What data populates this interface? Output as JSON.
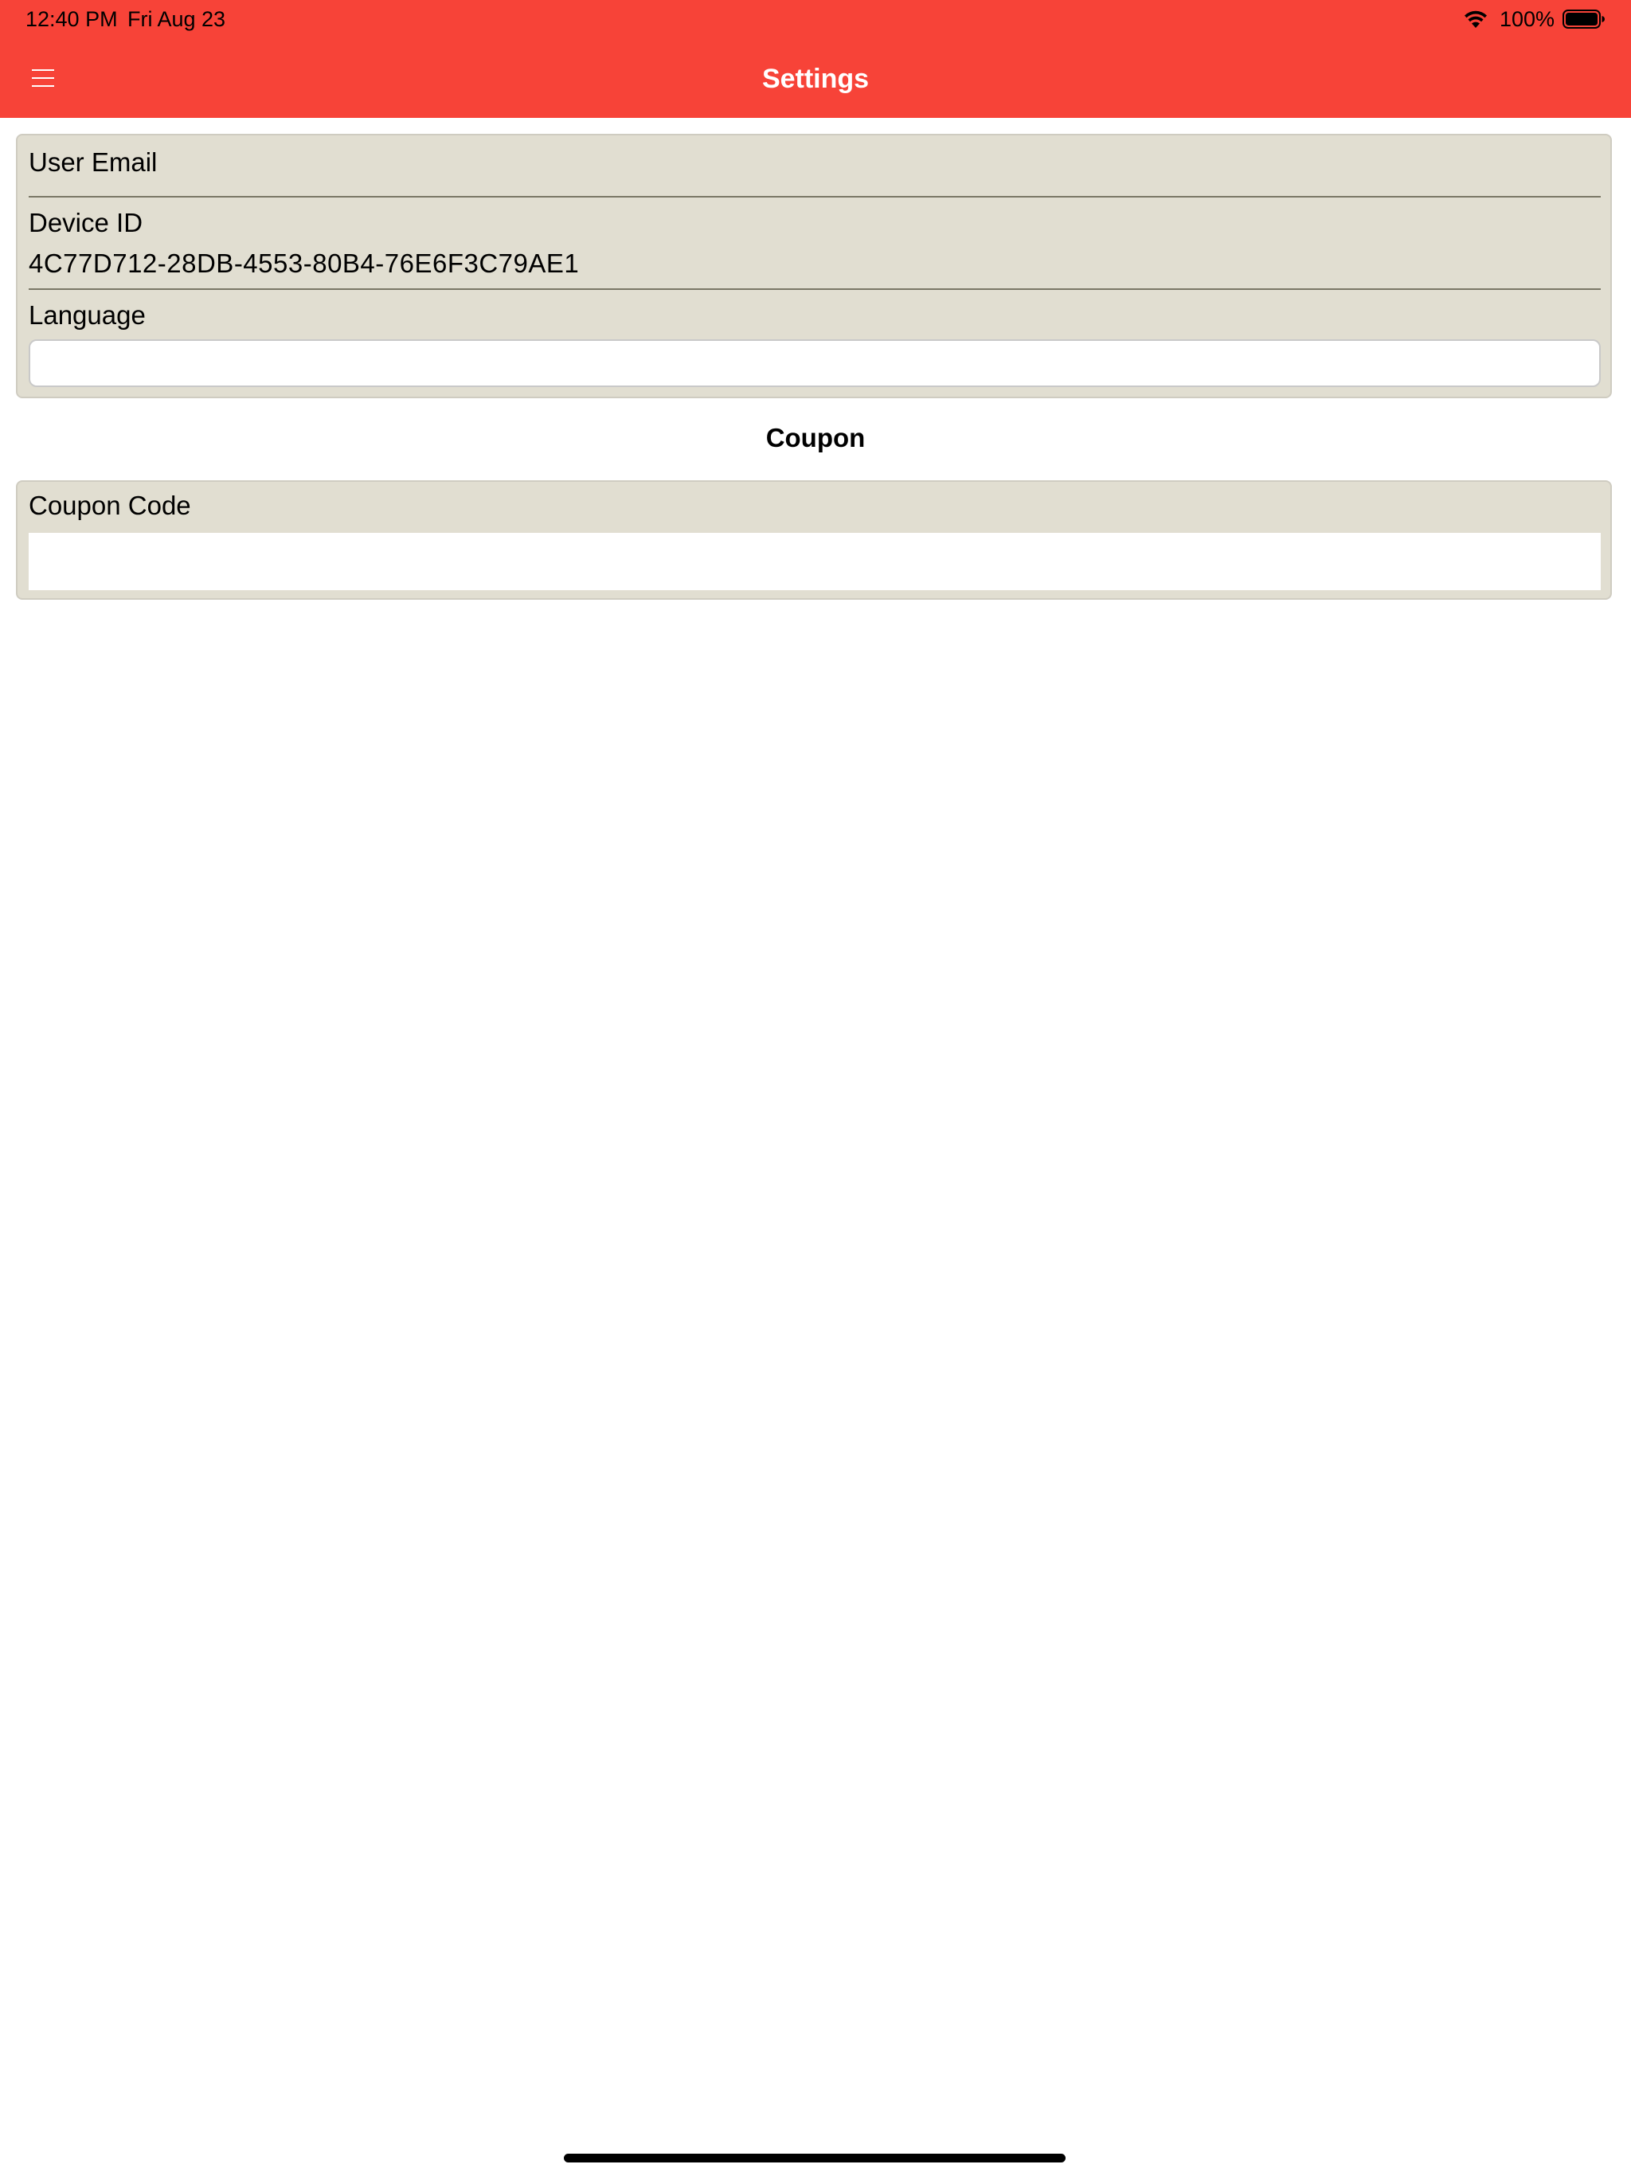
{
  "status_bar": {
    "time": "12:40 PM",
    "date": "Fri Aug 23",
    "battery": "100%"
  },
  "header": {
    "title": "Settings",
    "menu_icon": "hamburger-menu-icon",
    "background_color": "#F74338"
  },
  "settings_panel": {
    "user_email_label": "User Email",
    "user_email_value": "",
    "device_id_label": "Device ID",
    "device_id_value": "4C77D712-28DB-4553-80B4-76E6F3C79AE1",
    "language_label": "Language",
    "language_value": "",
    "panel_color": "#E1DED1"
  },
  "coupon_section": {
    "title": "Coupon",
    "coupon_code_label": "Coupon Code",
    "coupon_code_value": ""
  }
}
